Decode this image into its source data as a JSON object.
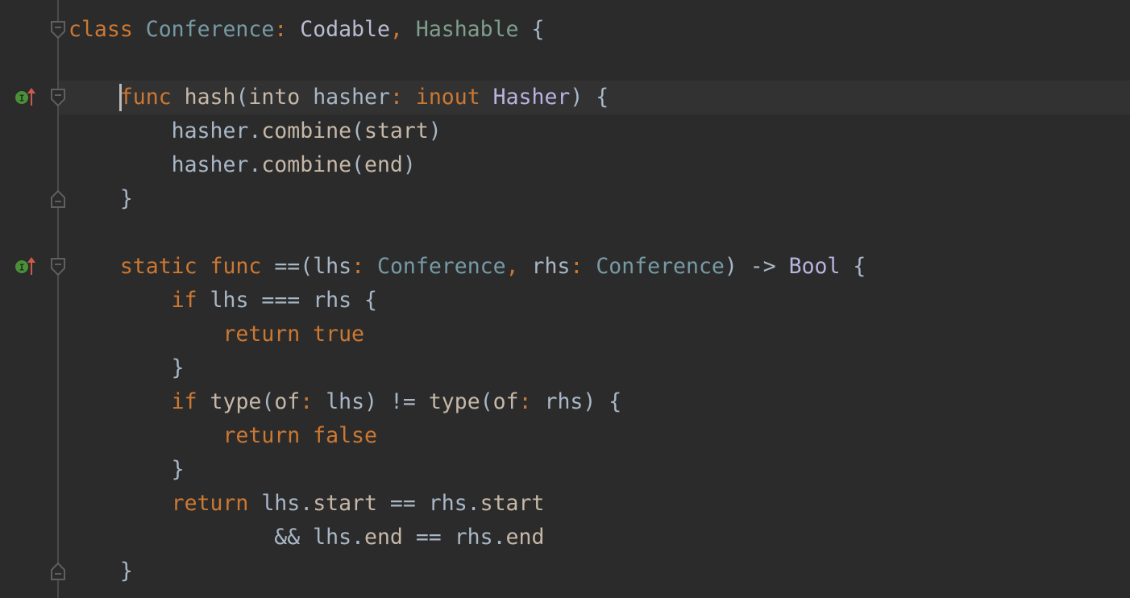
{
  "editor": {
    "language": "Swift",
    "current_line_index": 2,
    "colors": {
      "background": "#2b2b2b",
      "current_line": "#323232",
      "keyword": "#cc7832",
      "class_name": "#769aa5",
      "protocol_codable": "#b9bcd1",
      "protocol_hashable": "#7f9e8e",
      "type_ref": "#b8b3e0",
      "function_member": "#c6b8a8",
      "identifier": "#a9b7c6",
      "implements_icon": "#4a8f3a",
      "overrides_arrow": "#d05a4a"
    },
    "lines": [
      {
        "tokens": [
          {
            "t": "class",
            "c": "kw"
          },
          {
            "t": " "
          },
          {
            "t": "Conference",
            "c": "cls"
          },
          {
            "t": ":",
            "c": "colon"
          },
          {
            "t": " "
          },
          {
            "t": "Codable",
            "c": "proto1"
          },
          {
            "t": ",",
            "c": "colon"
          },
          {
            "t": " "
          },
          {
            "t": "Hashable",
            "c": "proto2"
          },
          {
            "t": " {",
            "c": "punct"
          }
        ]
      },
      {
        "tokens": []
      },
      {
        "tokens": [
          {
            "t": "    "
          },
          {
            "t": "func",
            "c": "kw"
          },
          {
            "t": " "
          },
          {
            "t": "hash",
            "c": "fn"
          },
          {
            "t": "(",
            "c": "punct"
          },
          {
            "t": "into",
            "c": "fn"
          },
          {
            "t": " "
          },
          {
            "t": "hasher",
            "c": "id"
          },
          {
            "t": ":",
            "c": "colon"
          },
          {
            "t": " "
          },
          {
            "t": "inout",
            "c": "kw"
          },
          {
            "t": " "
          },
          {
            "t": "Hasher",
            "c": "type"
          },
          {
            "t": ") {",
            "c": "punct"
          }
        ]
      },
      {
        "tokens": [
          {
            "t": "        "
          },
          {
            "t": "hasher",
            "c": "id"
          },
          {
            "t": ".",
            "c": "punct"
          },
          {
            "t": "combine",
            "c": "fn"
          },
          {
            "t": "(",
            "c": "punct"
          },
          {
            "t": "start",
            "c": "fn"
          },
          {
            "t": ")",
            "c": "punct"
          }
        ]
      },
      {
        "tokens": [
          {
            "t": "        "
          },
          {
            "t": "hasher",
            "c": "id"
          },
          {
            "t": ".",
            "c": "punct"
          },
          {
            "t": "combine",
            "c": "fn"
          },
          {
            "t": "(",
            "c": "punct"
          },
          {
            "t": "end",
            "c": "fn"
          },
          {
            "t": ")",
            "c": "punct"
          }
        ]
      },
      {
        "tokens": [
          {
            "t": "    "
          },
          {
            "t": "}",
            "c": "punct"
          }
        ]
      },
      {
        "tokens": []
      },
      {
        "tokens": [
          {
            "t": "    "
          },
          {
            "t": "static",
            "c": "kw"
          },
          {
            "t": " "
          },
          {
            "t": "func",
            "c": "kw"
          },
          {
            "t": " "
          },
          {
            "t": "==(",
            "c": "punct"
          },
          {
            "t": "lhs",
            "c": "id"
          },
          {
            "t": ":",
            "c": "colon"
          },
          {
            "t": " "
          },
          {
            "t": "Conference",
            "c": "cls"
          },
          {
            "t": ",",
            "c": "colon"
          },
          {
            "t": " "
          },
          {
            "t": "rhs",
            "c": "id"
          },
          {
            "t": ":",
            "c": "colon"
          },
          {
            "t": " "
          },
          {
            "t": "Conference",
            "c": "cls"
          },
          {
            "t": ") -> ",
            "c": "punct"
          },
          {
            "t": "Bool",
            "c": "type"
          },
          {
            "t": " {",
            "c": "punct"
          }
        ]
      },
      {
        "tokens": [
          {
            "t": "        "
          },
          {
            "t": "if",
            "c": "kw"
          },
          {
            "t": " "
          },
          {
            "t": "lhs",
            "c": "id"
          },
          {
            "t": " === ",
            "c": "punct"
          },
          {
            "t": "rhs",
            "c": "id"
          },
          {
            "t": " {",
            "c": "punct"
          }
        ]
      },
      {
        "tokens": [
          {
            "t": "            "
          },
          {
            "t": "return",
            "c": "kw"
          },
          {
            "t": " "
          },
          {
            "t": "true",
            "c": "kw"
          }
        ]
      },
      {
        "tokens": [
          {
            "t": "        "
          },
          {
            "t": "}",
            "c": "punct"
          }
        ]
      },
      {
        "tokens": [
          {
            "t": "        "
          },
          {
            "t": "if",
            "c": "kw"
          },
          {
            "t": " "
          },
          {
            "t": "type",
            "c": "fn"
          },
          {
            "t": "(",
            "c": "punct"
          },
          {
            "t": "of",
            "c": "fn"
          },
          {
            "t": ":",
            "c": "colon"
          },
          {
            "t": " "
          },
          {
            "t": "lhs",
            "c": "id"
          },
          {
            "t": ") != ",
            "c": "punct"
          },
          {
            "t": "type",
            "c": "fn"
          },
          {
            "t": "(",
            "c": "punct"
          },
          {
            "t": "of",
            "c": "fn"
          },
          {
            "t": ":",
            "c": "colon"
          },
          {
            "t": " "
          },
          {
            "t": "rhs",
            "c": "id"
          },
          {
            "t": ") {",
            "c": "punct"
          }
        ]
      },
      {
        "tokens": [
          {
            "t": "            "
          },
          {
            "t": "return",
            "c": "kw"
          },
          {
            "t": " "
          },
          {
            "t": "false",
            "c": "kw"
          }
        ]
      },
      {
        "tokens": [
          {
            "t": "        "
          },
          {
            "t": "}",
            "c": "punct"
          }
        ]
      },
      {
        "tokens": [
          {
            "t": "        "
          },
          {
            "t": "return",
            "c": "kw"
          },
          {
            "t": " "
          },
          {
            "t": "lhs",
            "c": "id"
          },
          {
            "t": ".",
            "c": "punct"
          },
          {
            "t": "start",
            "c": "fn"
          },
          {
            "t": " == ",
            "c": "punct"
          },
          {
            "t": "rhs",
            "c": "id"
          },
          {
            "t": ".",
            "c": "punct"
          },
          {
            "t": "start",
            "c": "fn"
          }
        ]
      },
      {
        "tokens": [
          {
            "t": "                "
          },
          {
            "t": "&& ",
            "c": "punct"
          },
          {
            "t": "lhs",
            "c": "id"
          },
          {
            "t": ".",
            "c": "punct"
          },
          {
            "t": "end",
            "c": "fn"
          },
          {
            "t": " == ",
            "c": "punct"
          },
          {
            "t": "rhs",
            "c": "id"
          },
          {
            "t": ".",
            "c": "punct"
          },
          {
            "t": "end",
            "c": "fn"
          }
        ]
      },
      {
        "tokens": [
          {
            "t": "    "
          },
          {
            "t": "}",
            "c": "punct"
          }
        ]
      }
    ],
    "gutter": {
      "fold_start_lines": [
        0,
        2,
        7
      ],
      "fold_end_lines": [
        5,
        16
      ],
      "implements_lines": [
        2,
        7
      ],
      "implements_icon_label": "I"
    }
  }
}
